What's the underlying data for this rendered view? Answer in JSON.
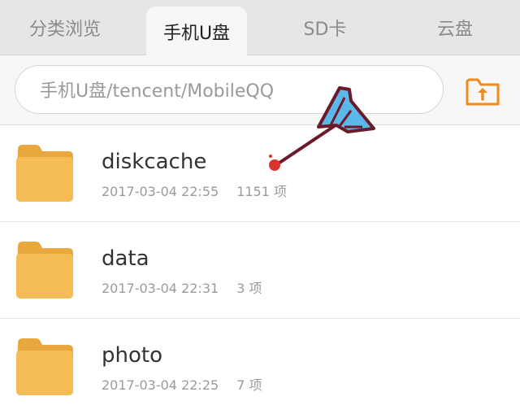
{
  "tabs": [
    {
      "label": "分类浏览",
      "active": false
    },
    {
      "label": "手机U盘",
      "active": true
    },
    {
      "label": "SD卡",
      "active": false
    },
    {
      "label": "云盘",
      "active": false
    }
  ],
  "path_bar": {
    "path": "手机U盘/tencent/MobileQQ",
    "up_icon": "folder-up-icon"
  },
  "folders": [
    {
      "name": "diskcache",
      "date": "2017-03-04 22:55",
      "count": "1151 项"
    },
    {
      "name": "data",
      "date": "2017-03-04 22:31",
      "count": "3 项"
    },
    {
      "name": "photo",
      "date": "2017-03-04 22:25",
      "count": "7 项"
    }
  ],
  "colors": {
    "accent": "#f08a1c",
    "folder": "#f2b54e",
    "arrow_blue": "#5cb8e8",
    "arrow_outline": "#6b1a2a",
    "arrow_tip": "#d9342b"
  }
}
